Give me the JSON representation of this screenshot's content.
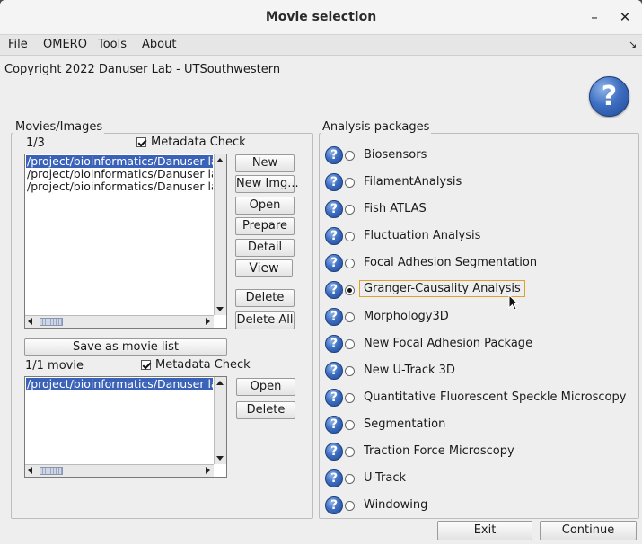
{
  "window": {
    "title": "Movie selection",
    "minimize": "–",
    "close": "✕"
  },
  "menu": [
    "File",
    "OMERO",
    "Tools",
    "About"
  ],
  "menu_overflow": "↘",
  "copyright": "Copyright 2022 Danuser Lab - UTSouthwestern",
  "movies_panel": {
    "title": "Movies/Images",
    "counter": "1/3",
    "metadata_check": "Metadata Check",
    "items": [
      "/project/bioinformatics/Danuser lab",
      "/project/bioinformatics/Danuser lab",
      "/project/bioinformatics/Danuser lab"
    ],
    "buttons": {
      "new": "New",
      "new_img": "New Img...",
      "open": "Open",
      "prepare": "Prepare",
      "detail": "Detail",
      "view": "View",
      "delete": "Delete",
      "delete_all": "Delete All"
    },
    "save_list": "Save as movie list",
    "movie_counter": "1/1 movie",
    "metadata_check_2": "Metadata Check",
    "list_items": [
      "/project/bioinformatics/Danuser lab"
    ],
    "list_buttons": {
      "open": "Open",
      "delete": "Delete"
    }
  },
  "packages_panel": {
    "title": "Analysis packages",
    "selected": "Granger-Causality Analysis",
    "items": [
      "Biosensors",
      "FilamentAnalysis",
      "Fish ATLAS",
      "Fluctuation Analysis",
      "Focal Adhesion Segmentation",
      "Granger-Causality Analysis",
      "Morphology3D",
      "New Focal Adhesion Package",
      "New U-Track 3D",
      "Quantitative Fluorescent Speckle Microscopy",
      "Segmentation",
      "Traction Force Microscopy",
      "U-Track",
      "Windowing"
    ]
  },
  "footer": {
    "exit": "Exit",
    "continue": "Continue"
  },
  "colors": {
    "selection": "#3a62b8",
    "help_icon": "#3f6fc2",
    "focus_border": "#e0a030"
  }
}
